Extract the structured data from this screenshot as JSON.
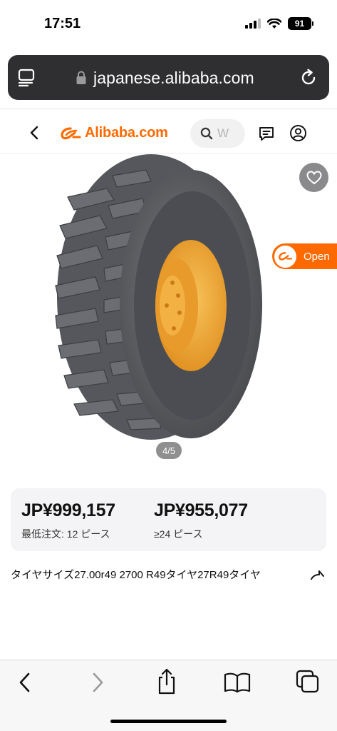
{
  "status_bar": {
    "time": "17:51",
    "battery": "91"
  },
  "browser": {
    "url": "japanese.alibaba.com"
  },
  "site_header": {
    "logo_text": "Alibaba.com",
    "search_placeholder": "W"
  },
  "gallery": {
    "page_indicator": "4/5",
    "open_app_label": "Open"
  },
  "pricing": [
    {
      "price": "JP¥999,157",
      "min_order": "最低注文: 12 ピース"
    },
    {
      "price": "JP¥955,077",
      "min_order": "≥24 ピース"
    }
  ],
  "product": {
    "title": "タイヤサイズ27.00r49 2700 R49タイヤ27R49タイヤ"
  },
  "colors": {
    "brand": "#ff6a00",
    "rim": "#f0a73a",
    "tire": "#5b5d62"
  }
}
